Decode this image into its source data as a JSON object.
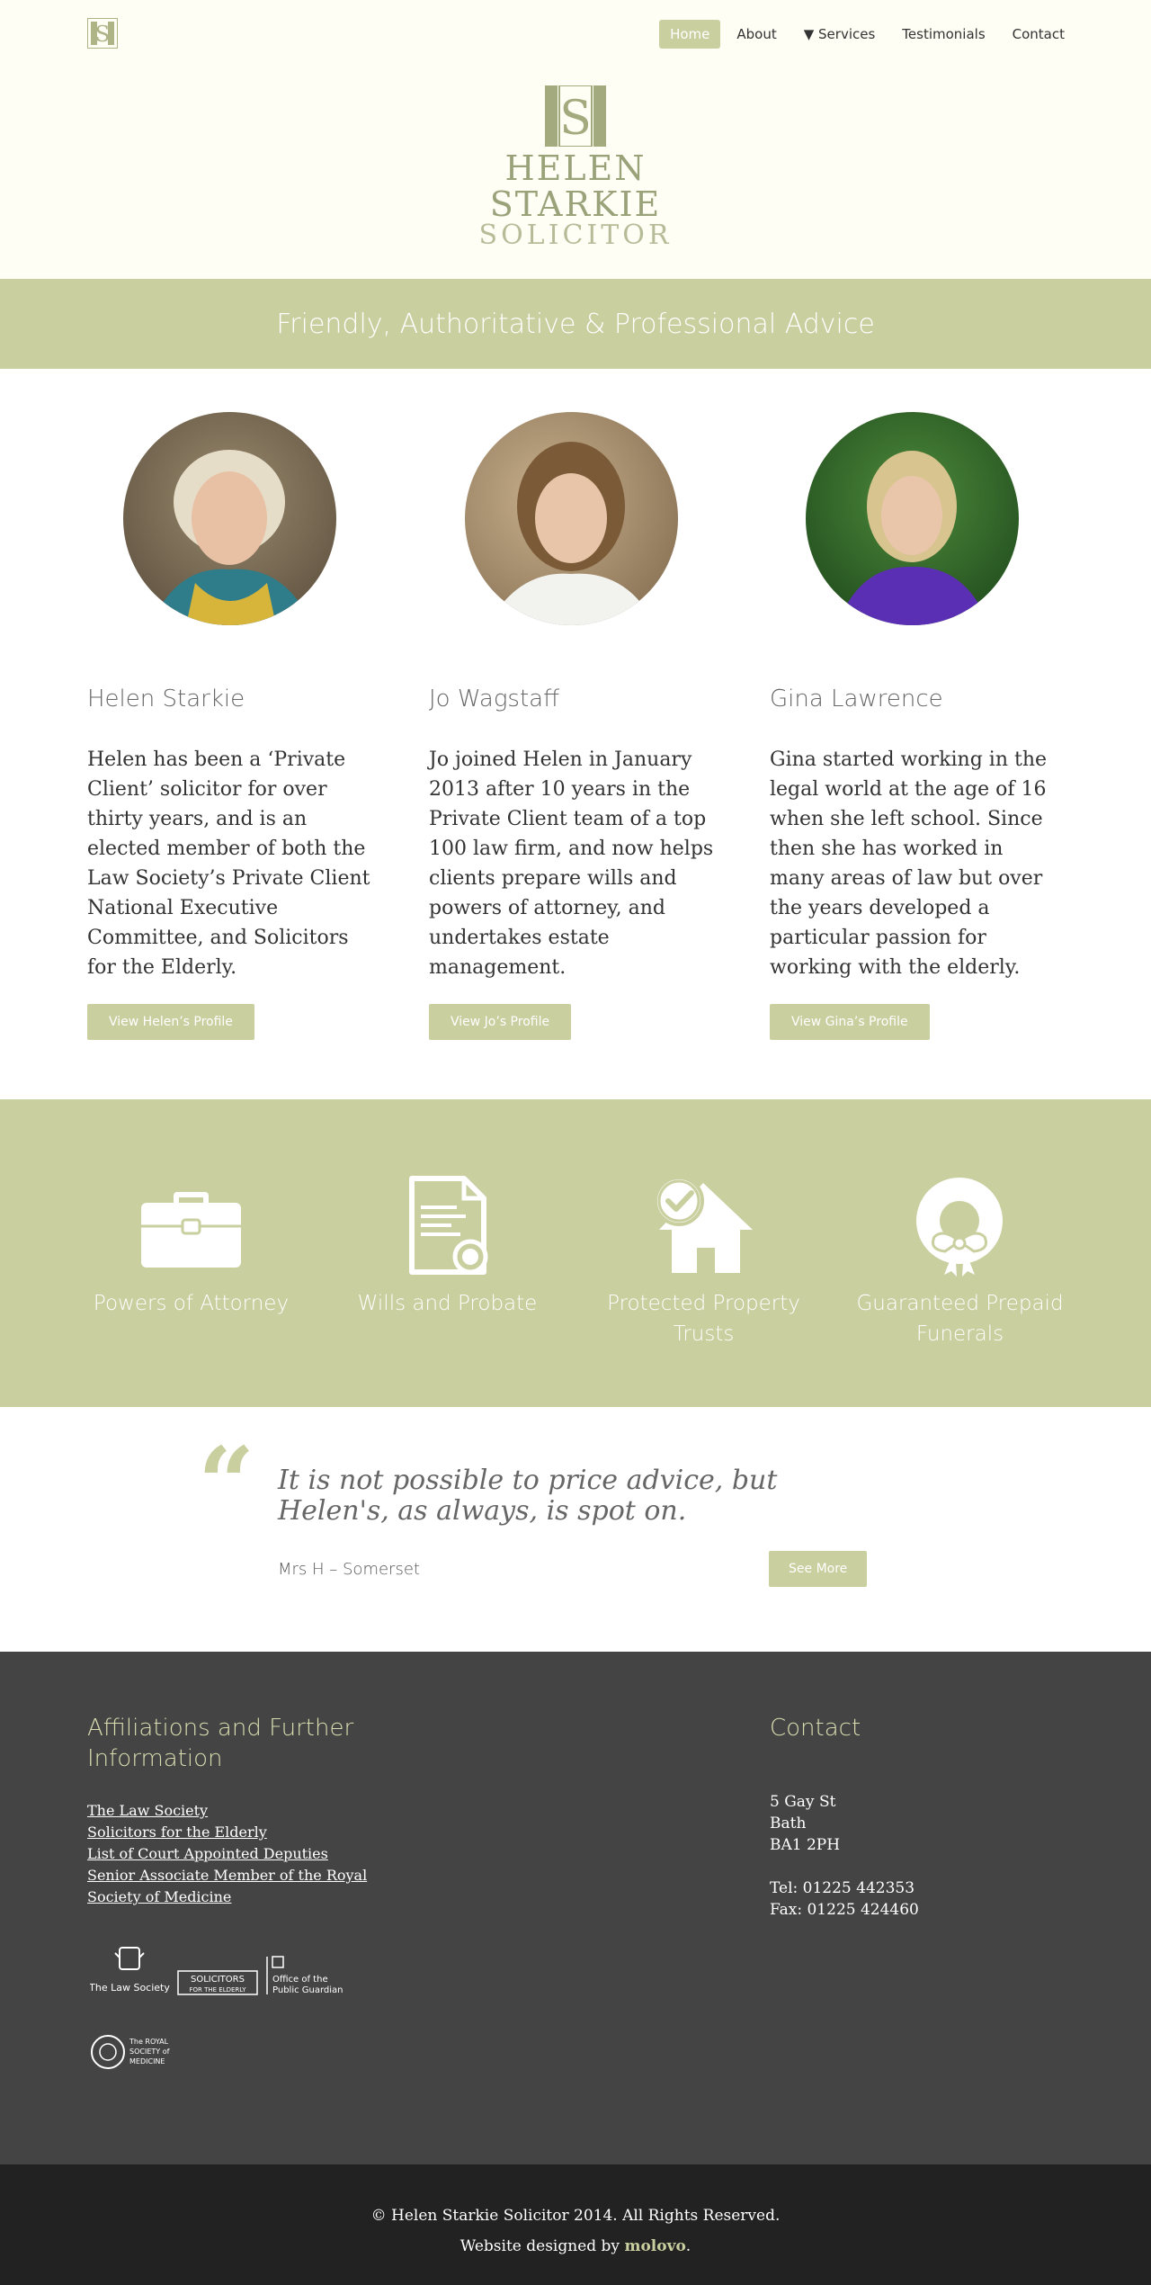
{
  "nav": {
    "items": [
      "Home",
      "About",
      "▼ Services",
      "Testimonials",
      "Contact"
    ],
    "active": "Home"
  },
  "logo": {
    "name": "HELEN STARKIE",
    "sub": "SOLICITOR",
    "monogram": "S"
  },
  "tagline": "Friendly, Authoritative & Professional Advice",
  "team": [
    {
      "name": "Helen Starkie",
      "bio": "Helen has been a ‘Private Client’ solicitor for over thirty years, and is an elected member of both the Law Society’s Private Client National Executive Committee, and Solicitors for the Elderly.",
      "button": "View Helen’s Profile"
    },
    {
      "name": "Jo Wagstaff",
      "bio": "Jo joined Helen in January 2013 after 10 years in the Private Client team of a top 100 law firm, and now helps clients prepare wills and powers of attorney, and undertakes estate management.",
      "button": "View Jo’s Profile"
    },
    {
      "name": "Gina Lawrence",
      "bio": "Gina started working in the legal world at the age of 16 when she left school. Since then she has worked in many areas of law but over the years developed a particular passion for working with the elderly.",
      "button": "View Gina’s Profile"
    }
  ],
  "services": [
    {
      "label": "Powers of Attorney",
      "icon": "briefcase-icon"
    },
    {
      "label": "Wills and Probate",
      "icon": "document-icon"
    },
    {
      "label": "Protected Property Trusts",
      "icon": "house-check-icon"
    },
    {
      "label": "Guaranteed Prepaid Funerals",
      "icon": "wreath-icon"
    }
  ],
  "testimonial": {
    "quote": "It is not possible to price advice, but Helen's, as always, is spot on.",
    "author": "Mrs H – Somerset",
    "button": "See More"
  },
  "footer": {
    "affiliations_title": "Affiliations and Further Information",
    "links": [
      "The Law Society",
      "Solicitors for the Elderly",
      "List of Court Appointed Deputies",
      "Senior Associate Member of the Royal Society of Medicine"
    ],
    "logos": {
      "law_society": "The Law Society",
      "sfe_top": "SOLICITORS",
      "sfe_bottom": "FOR THE ELDERLY",
      "opg_1": "Office of the",
      "opg_2": "Public Guardian",
      "rsm_1": "The ROYAL",
      "rsm_2": "SOCIETY of",
      "rsm_3": "MEDICINE"
    },
    "contact_title": "Contact",
    "address": [
      "5 Gay St",
      "Bath",
      "BA1 2PH"
    ],
    "tel": "Tel: 01225 442353",
    "fax": "Fax: 01225 424460"
  },
  "copyright": {
    "line1": "© Helen Starkie Solicitor 2014. All Rights Reserved.",
    "designed_by": "Website designed by",
    "designer": "molovo",
    "period": "."
  },
  "colors": {
    "accent": "#c9cf9f",
    "header_bg": "#fefef5",
    "footer_bg": "#444444",
    "copyright_bg": "#222222"
  }
}
